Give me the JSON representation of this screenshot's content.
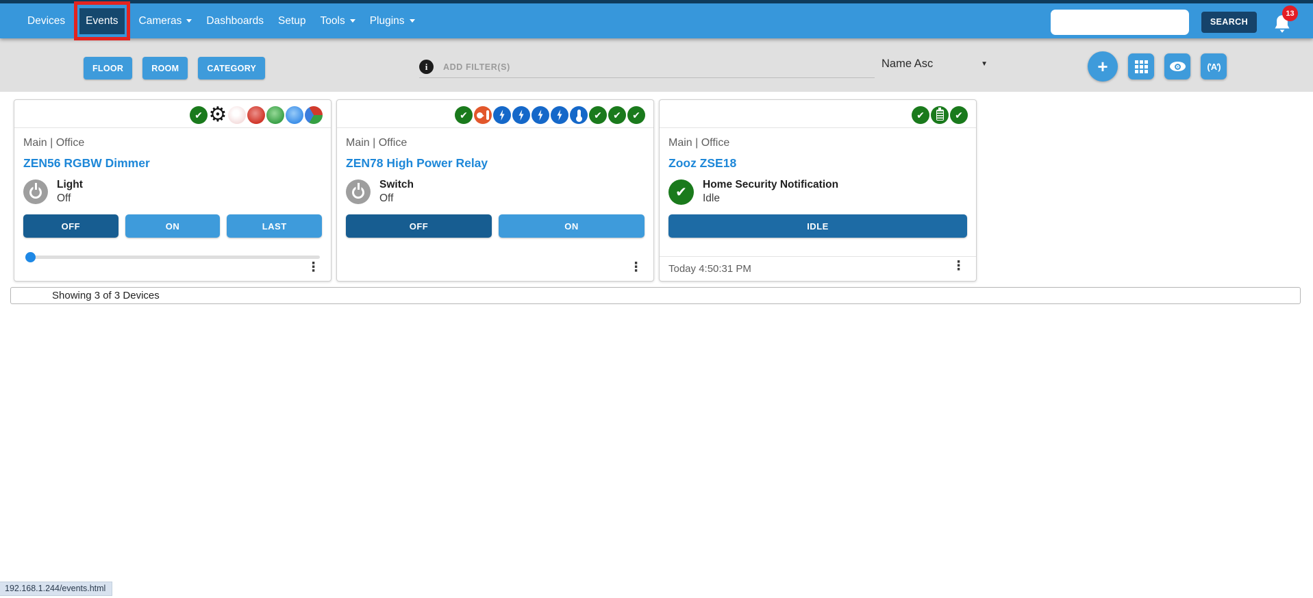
{
  "navbar": {
    "items": [
      {
        "label": "Devices",
        "caret": false,
        "active": false
      },
      {
        "label": "Events",
        "caret": false,
        "active": true,
        "annotated": true
      },
      {
        "label": "Cameras",
        "caret": true,
        "active": false
      },
      {
        "label": "Dashboards",
        "caret": false,
        "active": false
      },
      {
        "label": "Setup",
        "caret": false,
        "active": false
      },
      {
        "label": "Tools",
        "caret": true,
        "active": false
      },
      {
        "label": "Plugins",
        "caret": true,
        "active": false
      }
    ],
    "search": {
      "value": "",
      "placeholder": "",
      "button_label": "SEARCH"
    },
    "notifications": {
      "count": "13",
      "icon": "bell-icon"
    }
  },
  "toolbar": {
    "filter_buttons": [
      {
        "label": "FLOOR"
      },
      {
        "label": "ROOM"
      },
      {
        "label": "CATEGORY"
      }
    ],
    "add_filters": {
      "placeholder": "ADD FILTER(S)",
      "icon": "info-icon"
    },
    "sort": {
      "value": "Name Asc",
      "icon": "chevron-down-icon"
    },
    "action_buttons": [
      {
        "icon": "plus-icon",
        "name": "add-button"
      },
      {
        "icon": "grid-icon",
        "name": "grid-view-button"
      },
      {
        "icon": "eye-icon",
        "name": "visibility-button"
      },
      {
        "icon": "antenna-icon",
        "name": "zwave-antenna-button"
      }
    ]
  },
  "cards": [
    {
      "location": "Main | Office",
      "name": "ZEN56 RGBW Dimmer",
      "status_icons": [
        "status-ok-icon",
        "gear-icon",
        "color-white-swatch-icon",
        "color-red-swatch-icon",
        "color-green-swatch-icon",
        "color-blue-swatch-icon",
        "color-rgb-swatch-icon"
      ],
      "feature": {
        "icon": "power-icon",
        "label": "Light",
        "value": "Off"
      },
      "buttons": [
        {
          "label": "OFF",
          "active": true
        },
        {
          "label": "ON",
          "active": false
        },
        {
          "label": "LAST",
          "active": false
        }
      ],
      "slider": {
        "value": 0,
        "min": 0,
        "max": 100
      },
      "timestamp": ""
    },
    {
      "location": "Main | Office",
      "name": "ZEN78 High Power Relay",
      "status_icons": [
        "status-ok-icon",
        "power-plug-icon",
        "energy-bolt-icon",
        "energy-bolt-icon",
        "energy-bolt-icon",
        "energy-bolt-icon",
        "temperature-icon",
        "status-ok-icon",
        "status-ok-icon",
        "status-ok-icon"
      ],
      "feature": {
        "icon": "power-icon",
        "label": "Switch",
        "value": "Off"
      },
      "buttons": [
        {
          "label": "OFF",
          "active": true
        },
        {
          "label": "ON",
          "active": false
        }
      ],
      "slider": null,
      "timestamp": ""
    },
    {
      "location": "Main | Office",
      "name": "Zooz ZSE18",
      "status_icons": [
        "status-ok-icon",
        "battery-icon",
        "status-ok-icon"
      ],
      "feature": {
        "icon": "check-ok-icon",
        "label": "Home Security Notification",
        "value": "Idle"
      },
      "buttons": [
        {
          "label": "IDLE",
          "active": true,
          "state_button": true
        }
      ],
      "slider": null,
      "timestamp": "Today 4:50:31 PM"
    }
  ],
  "footer_bar": {
    "text": "Showing 3 of 3 Devices"
  },
  "status_tooltip": {
    "text": "192.168.1.244/events.html"
  },
  "colors": {
    "navbar": "#3797db",
    "navbar_top_strip": "#0e3b5c",
    "nav_active_bg": "#15486e",
    "annotation_red": "#e32420",
    "toolbar_bg": "#e0e0e0",
    "accent_button": "#3e9bdb",
    "button_active": "#175d91",
    "state_button": "#1d6ba5",
    "device_link": "#1d87d8",
    "ok_green": "#1a7a1c",
    "bolt_blue": "#1568c9",
    "alert_orange": "#e2572b",
    "badge_red": "#e41e26"
  }
}
